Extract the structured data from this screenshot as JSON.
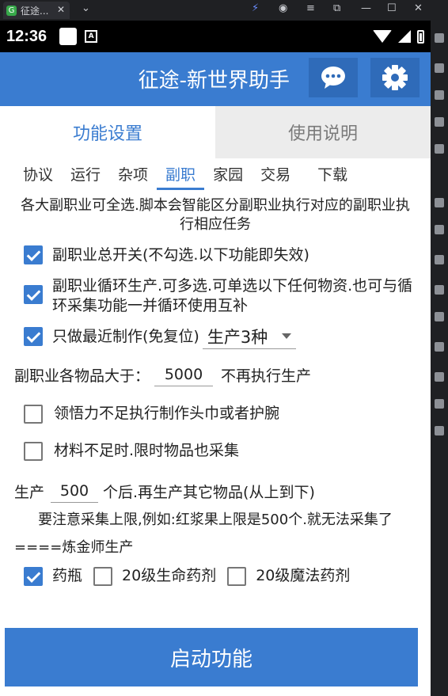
{
  "emulator": {
    "tab_title": "征途...",
    "app_badge": "G",
    "controls": [
      "⚡",
      "◉",
      "≡",
      "⧉",
      "—",
      "☐",
      "✕"
    ]
  },
  "status_bar": {
    "time": "12:36",
    "notif_icon": "A"
  },
  "app_bar": {
    "title": "征途-新世界助手",
    "chat_icon": "chat-icon",
    "settings_icon": "gear-icon"
  },
  "main_tabs": [
    {
      "label": "功能设置",
      "active": true
    },
    {
      "label": "使用说明",
      "active": false
    }
  ],
  "sub_tabs": [
    {
      "label": "协议",
      "active": false
    },
    {
      "label": "运行",
      "active": false
    },
    {
      "label": "杂项",
      "active": false
    },
    {
      "label": "副职",
      "active": true
    },
    {
      "label": "家园",
      "active": false
    },
    {
      "label": "交易",
      "active": false
    },
    {
      "label": "下载",
      "active": false
    }
  ],
  "content": {
    "description": "各大副职业可全选.脚本会智能区分副职业执行对应的副职业执行相应任务",
    "options": {
      "master_switch": {
        "label": "副职业总开关(不勾选.以下功能即失效)",
        "checked": true
      },
      "cycle_produce": {
        "label": "副职业循环生产.可多选.可单选以下任何物资.也可与循环采集功能一并循环使用互补",
        "checked": true
      },
      "recent_only": {
        "label": "只做最近制作(免复位)",
        "checked": true,
        "select_value": "生产3种"
      }
    },
    "threshold": {
      "prefix": "副职业各物品大于：",
      "value": "5000",
      "suffix": "不再执行生产"
    },
    "comprehend": {
      "label": "领悟力不足执行制作头巾或者护腕",
      "checked": false
    },
    "material": {
      "label": "材料不足时.限时物品也采集",
      "checked": false
    },
    "produce_count": {
      "prefix": "生产",
      "value": "500",
      "suffix": "个后.再生产其它物品(从上到下)"
    },
    "note": "要注意采集上限,例如:红浆果上限是500个.就无法采集了",
    "alchemist_header": "====炼金师生产",
    "alchemist_items": [
      {
        "label": "药瓶",
        "checked": true
      },
      {
        "label": "20级生命药剂",
        "checked": false
      },
      {
        "label": "20级魔法药剂",
        "checked": false
      }
    ],
    "start_button": "启动功能"
  }
}
